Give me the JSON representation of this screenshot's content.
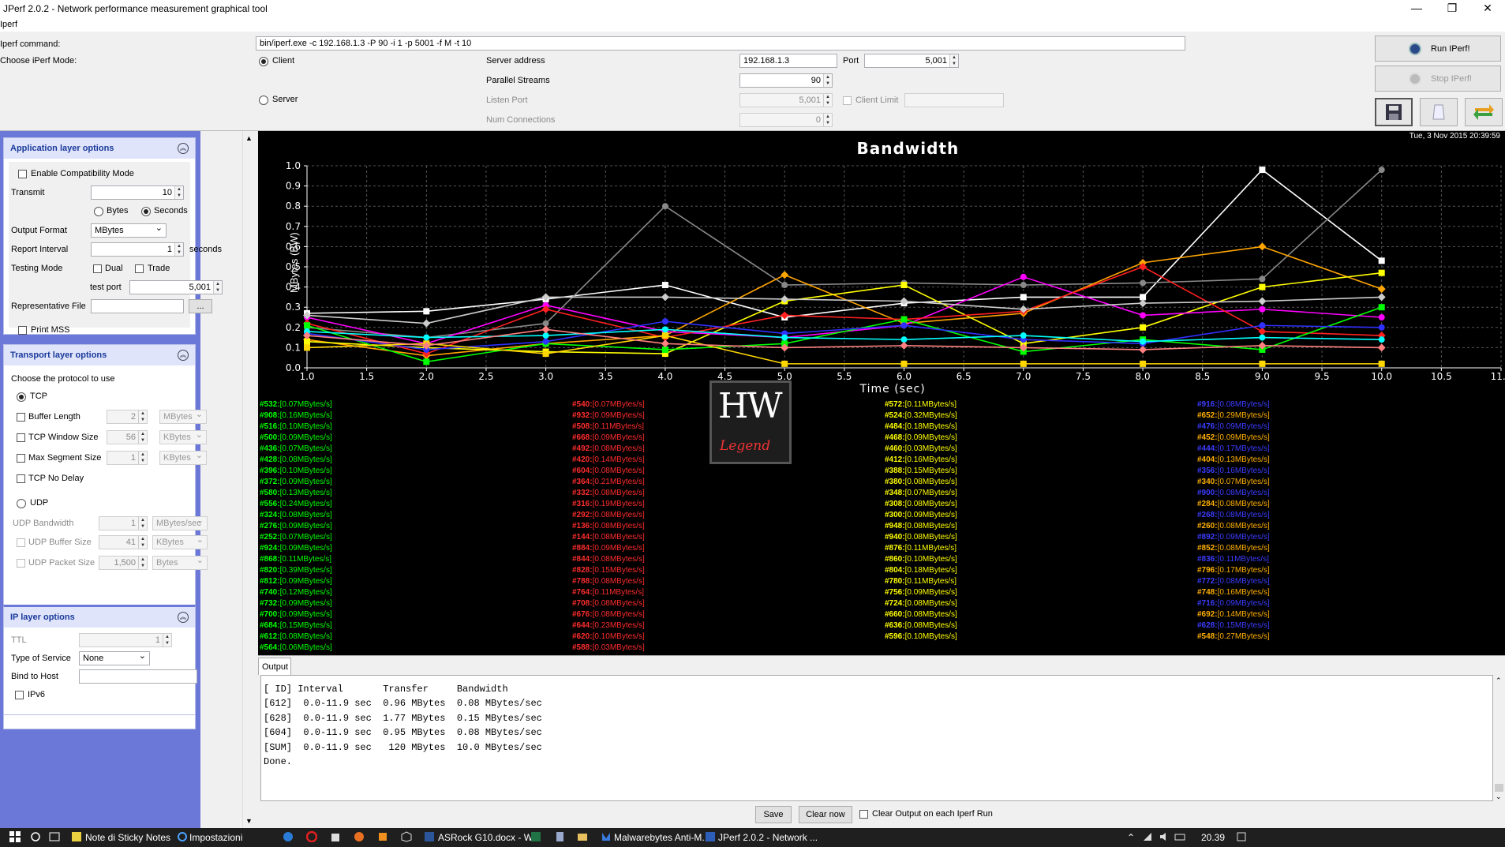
{
  "window": {
    "title": "JPerf 2.0.2 - Network performance measurement graphical tool",
    "minimize": "—",
    "maximize": "❐",
    "close": "✕"
  },
  "menu": {
    "label": "Iperf"
  },
  "command": {
    "label": "Iperf command:",
    "value": "bin/iperf.exe -c 192.168.1.3 -P 90 -i 1 -p 5001 -f M -t 10"
  },
  "mode": {
    "label": "Choose iPerf Mode:",
    "client": "Client",
    "server": "Server",
    "selected": "Client"
  },
  "client": {
    "server_address_label": "Server address",
    "server_address": "192.168.1.3",
    "port_label": "Port",
    "port": "5,001",
    "parallel_label": "Parallel Streams",
    "parallel": "90"
  },
  "server": {
    "listen_port_label": "Listen Port",
    "listen_port": "5,001",
    "client_limit_label": "Client Limit",
    "client_limit": "",
    "num_conn_label": "Num Connections",
    "num_conn": "0"
  },
  "buttons": {
    "run": "Run IPerf!",
    "stop": "Stop IPerf!"
  },
  "app_layer": {
    "title": "Application layer options",
    "compat": "Enable Compatibility Mode",
    "transmit_label": "Transmit",
    "transmit": "10",
    "bytes": "Bytes",
    "seconds": "Seconds",
    "output_format_label": "Output Format",
    "output_format": "MBytes",
    "report_label": "Report Interval",
    "report": "1",
    "report_unit": "seconds",
    "testing_label": "Testing Mode",
    "dual": "Dual",
    "trade": "Trade",
    "test_port_label": "test port",
    "test_port": "5,001",
    "rep_file_label": "Representative File",
    "rep_file": "",
    "browse": "...",
    "print_mss": "Print MSS"
  },
  "transport": {
    "title": "Transport layer options",
    "choose": "Choose the protocol to use",
    "tcp": "TCP",
    "buffer_label": "Buffer Length",
    "buffer": "2",
    "buffer_unit": "MBytes",
    "window_label": "TCP Window Size",
    "window": "56",
    "window_unit": "KBytes",
    "mss_label": "Max Segment Size",
    "mss": "1",
    "mss_unit": "KBytes",
    "nodelay": "TCP No Delay",
    "udp": "UDP",
    "udp_bw_label": "UDP Bandwidth",
    "udp_bw": "1",
    "udp_bw_unit": "MBytes/sec",
    "udp_buf_label": "UDP Buffer Size",
    "udp_buf": "41",
    "udp_buf_unit": "KBytes",
    "udp_pkt_label": "UDP Packet Size",
    "udp_pkt": "1,500",
    "udp_pkt_unit": "Bytes"
  },
  "ip_layer": {
    "title": "IP layer options",
    "ttl_label": "TTL",
    "ttl": "1",
    "tos_label": "Type of Service",
    "tos": "None",
    "bind_label": "Bind to Host",
    "bind": "",
    "ipv6": "IPv6"
  },
  "graph": {
    "timestamp": "Tue, 3 Nov 2015 20:39:59",
    "watermark_top": "HW",
    "watermark_bottom": "Legend"
  },
  "chart_data": {
    "type": "line",
    "title": "Bandwidth",
    "xlabel": "Time (sec)",
    "ylabel": "MBytes (BW)",
    "xlim": [
      1.0,
      11.0
    ],
    "ylim": [
      0.0,
      1.0
    ],
    "xticks": [
      "1.0",
      "1.5",
      "2.0",
      "2.5",
      "3.0",
      "3.5",
      "4.0",
      "4.5",
      "5.0",
      "5.5",
      "6.0",
      "6.5",
      "7.0",
      "7.5",
      "8.0",
      "8.5",
      "9.0",
      "9.5",
      "10.0",
      "10.5",
      "11.0"
    ],
    "yticks": [
      "0.0",
      "0.1",
      "0.2",
      "0.3",
      "0.4",
      "0.5",
      "0.6",
      "0.7",
      "0.8",
      "0.9",
      "1.0"
    ],
    "grid": true,
    "x": [
      1,
      2,
      3,
      4,
      5,
      6,
      7,
      8,
      9,
      10
    ],
    "series": [
      {
        "color": "#ffffff",
        "values": [
          0.27,
          0.28,
          0.34,
          0.41,
          0.25,
          0.32,
          0.35,
          0.35,
          0.98,
          0.53
        ]
      },
      {
        "color": "#888888",
        "values": [
          0.2,
          0.15,
          0.22,
          0.8,
          0.41,
          0.42,
          0.41,
          0.42,
          0.44,
          0.98
        ]
      },
      {
        "color": "#ffa500",
        "values": [
          0.14,
          0.06,
          0.12,
          0.16,
          0.46,
          0.22,
          0.27,
          0.52,
          0.6,
          0.39
        ]
      },
      {
        "color": "#ffff00",
        "values": [
          0.13,
          0.1,
          0.08,
          0.07,
          0.33,
          0.41,
          0.12,
          0.2,
          0.4,
          0.47
        ]
      },
      {
        "color": "#ff00ff",
        "values": [
          0.25,
          0.12,
          0.31,
          0.18,
          0.15,
          0.21,
          0.45,
          0.26,
          0.29,
          0.25
        ]
      },
      {
        "color": "#ff2020",
        "values": [
          0.22,
          0.07,
          0.29,
          0.15,
          0.26,
          0.24,
          0.28,
          0.5,
          0.18,
          0.16
        ]
      },
      {
        "color": "#00ff00",
        "values": [
          0.21,
          0.03,
          0.12,
          0.09,
          0.12,
          0.24,
          0.08,
          0.14,
          0.09,
          0.3
        ]
      },
      {
        "color": "#3030ff",
        "values": [
          0.17,
          0.09,
          0.13,
          0.23,
          0.17,
          0.21,
          0.14,
          0.12,
          0.21,
          0.2
        ]
      },
      {
        "color": "#cccccc",
        "values": [
          0.26,
          0.22,
          0.35,
          0.35,
          0.34,
          0.33,
          0.29,
          0.32,
          0.33,
          0.35
        ]
      },
      {
        "color": "#ffd700",
        "values": [
          0.1,
          0.12,
          0.07,
          0.16,
          0.02,
          0.02,
          0.02,
          0.02,
          0.02,
          0.02
        ]
      },
      {
        "color": "#00ffff",
        "values": [
          0.18,
          0.15,
          0.16,
          0.19,
          0.15,
          0.14,
          0.16,
          0.13,
          0.15,
          0.14
        ]
      },
      {
        "color": "#ff8080",
        "values": [
          0.16,
          0.11,
          0.19,
          0.12,
          0.1,
          0.11,
          0.1,
          0.09,
          0.11,
          0.1
        ]
      }
    ]
  },
  "legend": {
    "columns": [
      {
        "name_color": "#00ff00",
        "items": [
          [
            "#532:",
            "[0.07MBytes/s]"
          ],
          [
            "#908:",
            "[0.16MBytes/s]"
          ],
          [
            "#516:",
            "[0.10MBytes/s]"
          ],
          [
            "#500:",
            "[0.09MBytes/s]"
          ],
          [
            "#436:",
            "[0.07MBytes/s]"
          ],
          [
            "#428:",
            "[0.08MBytes/s]"
          ],
          [
            "#396:",
            "[0.10MBytes/s]"
          ],
          [
            "#372:",
            "[0.09MBytes/s]"
          ],
          [
            "#580:",
            "[0.13MBytes/s]"
          ],
          [
            "#556:",
            "[0.24MBytes/s]"
          ],
          [
            "#324:",
            "[0.08MBytes/s]"
          ],
          [
            "#276:",
            "[0.09MBytes/s]"
          ],
          [
            "#252:",
            "[0.07MBytes/s]"
          ],
          [
            "#924:",
            "[0.09MBytes/s]"
          ],
          [
            "#868:",
            "[0.11MBytes/s]"
          ],
          [
            "#820:",
            "[0.39MBytes/s]"
          ],
          [
            "#812:",
            "[0.09MBytes/s]"
          ],
          [
            "#740:",
            "[0.12MBytes/s]"
          ],
          [
            "#732:",
            "[0.09MBytes/s]"
          ],
          [
            "#700:",
            "[0.09MBytes/s]"
          ],
          [
            "#684:",
            "[0.15MBytes/s]"
          ],
          [
            "#612:",
            "[0.08MBytes/s]"
          ],
          [
            "#564:",
            "[0.06MBytes/s]"
          ]
        ]
      },
      {
        "name_color": "#ff2d2d",
        "items": [
          [
            "#540:",
            "[0.07MBytes/s]"
          ],
          [
            "#932:",
            "[0.09MBytes/s]"
          ],
          [
            "#508:",
            "[0.11MBytes/s]"
          ],
          [
            "#668:",
            "[0.09MBytes/s]"
          ],
          [
            "#492:",
            "[0.08MBytes/s]"
          ],
          [
            "#420:",
            "[0.14MBytes/s]"
          ],
          [
            "#604:",
            "[0.08MBytes/s]"
          ],
          [
            "#364:",
            "[0.21MBytes/s]"
          ],
          [
            "#332:",
            "[0.08MBytes/s]"
          ],
          [
            "#316:",
            "[0.19MBytes/s]"
          ],
          [
            "#292:",
            "[0.08MBytes/s]"
          ],
          [
            "#136:",
            "[0.08MBytes/s]"
          ],
          [
            "#144:",
            "[0.08MBytes/s]"
          ],
          [
            "#884:",
            "[0.09MBytes/s]"
          ],
          [
            "#844:",
            "[0.08MBytes/s]"
          ],
          [
            "#828:",
            "[0.15MBytes/s]"
          ],
          [
            "#788:",
            "[0.08MBytes/s]"
          ],
          [
            "#764:",
            "[0.11MBytes/s]"
          ],
          [
            "#708:",
            "[0.08MBytes/s]"
          ],
          [
            "#676:",
            "[0.08MBytes/s]"
          ],
          [
            "#644:",
            "[0.23MBytes/s]"
          ],
          [
            "#620:",
            "[0.10MBytes/s]"
          ],
          [
            "#588:",
            "[0.03MBytes/s]"
          ]
        ]
      },
      {
        "name_color": "#ffff00",
        "items": [
          [
            "#572:",
            "[0.11MBytes/s]"
          ],
          [
            "#524:",
            "[0.32MBytes/s]"
          ],
          [
            "#484:",
            "[0.18MBytes/s]"
          ],
          [
            "#468:",
            "[0.09MBytes/s]"
          ],
          [
            "#460:",
            "[0.03MBytes/s]"
          ],
          [
            "#412:",
            "[0.16MBytes/s]"
          ],
          [
            "#388:",
            "[0.15MBytes/s]"
          ],
          [
            "#380:",
            "[0.08MBytes/s]"
          ],
          [
            "#348:",
            "[0.07MBytes/s]"
          ],
          [
            "#308:",
            "[0.08MBytes/s]"
          ],
          [
            "#300:",
            "[0.09MBytes/s]"
          ],
          [
            "#948:",
            "[0.08MBytes/s]"
          ],
          [
            "#940:",
            "[0.08MBytes/s]"
          ],
          [
            "#876:",
            "[0.11MBytes/s]"
          ],
          [
            "#860:",
            "[0.10MBytes/s]"
          ],
          [
            "#804:",
            "[0.18MBytes/s]"
          ],
          [
            "#780:",
            "[0.11MBytes/s]"
          ],
          [
            "#756:",
            "[0.09MBytes/s]"
          ],
          [
            "#724:",
            "[0.08MBytes/s]"
          ],
          [
            "#660:",
            "[0.08MBytes/s]"
          ],
          [
            "#636:",
            "[0.08MBytes/s]"
          ],
          [
            "#596:",
            "[0.10MBytes/s]"
          ]
        ]
      },
      {
        "name_color": "#ffb000",
        "items": [
          [
            "#916:",
            "[0.08MBytes/s]"
          ],
          [
            "#652:",
            "[0.29MBytes/s]"
          ],
          [
            "#476:",
            "[0.09MBytes/s]"
          ],
          [
            "#452:",
            "[0.09MBytes/s]"
          ],
          [
            "#444:",
            "[0.17MBytes/s]"
          ],
          [
            "#404:",
            "[0.13MBytes/s]"
          ],
          [
            "#356:",
            "[0.16MBytes/s]"
          ],
          [
            "#340:",
            "[0.07MBytes/s]"
          ],
          [
            "#900:",
            "[0.08MBytes/s]"
          ],
          [
            "#284:",
            "[0.08MBytes/s]"
          ],
          [
            "#268:",
            "[0.08MBytes/s]"
          ],
          [
            "#260:",
            "[0.08MBytes/s]"
          ],
          [
            "#892:",
            "[0.09MBytes/s]"
          ],
          [
            "#852:",
            "[0.08MBytes/s]"
          ],
          [
            "#836:",
            "[0.11MBytes/s]"
          ],
          [
            "#796:",
            "[0.17MBytes/s]"
          ],
          [
            "#772:",
            "[0.08MBytes/s]"
          ],
          [
            "#748:",
            "[0.16MBytes/s]"
          ],
          [
            "#716:",
            "[0.09MBytes/s]"
          ],
          [
            "#692:",
            "[0.14MBytes/s]"
          ],
          [
            "#628:",
            "[0.15MBytes/s]"
          ],
          [
            "#548:",
            "[0.27MBytes/s]"
          ]
        ],
        "alt_color": "#3c3cff",
        "alt_rows": [
          0,
          2,
          4,
          6,
          8,
          10,
          12,
          14,
          16,
          18,
          20
        ]
      }
    ]
  },
  "output": {
    "tab": "Output",
    "lines": [
      "[ ID] Interval       Transfer     Bandwidth",
      "[612]  0.0-11.9 sec  0.96 MBytes  0.08 MBytes/sec",
      "[628]  0.0-11.9 sec  1.77 MBytes  0.15 MBytes/sec",
      "[604]  0.0-11.9 sec  0.95 MBytes  0.08 MBytes/sec",
      "[SUM]  0.0-11.9 sec   120 MBytes  10.0 MBytes/sec",
      "Done."
    ],
    "save": "Save",
    "clear": "Clear now",
    "clear_each": "Clear Output on each Iperf Run"
  },
  "taskbar": {
    "items": [
      "Note di Sticky Notes",
      "Impostazioni",
      "ASRock G10.docx - W...",
      "Malwarebytes Anti-M...",
      "JPerf 2.0.2 - Network ..."
    ],
    "time": "20.39"
  }
}
